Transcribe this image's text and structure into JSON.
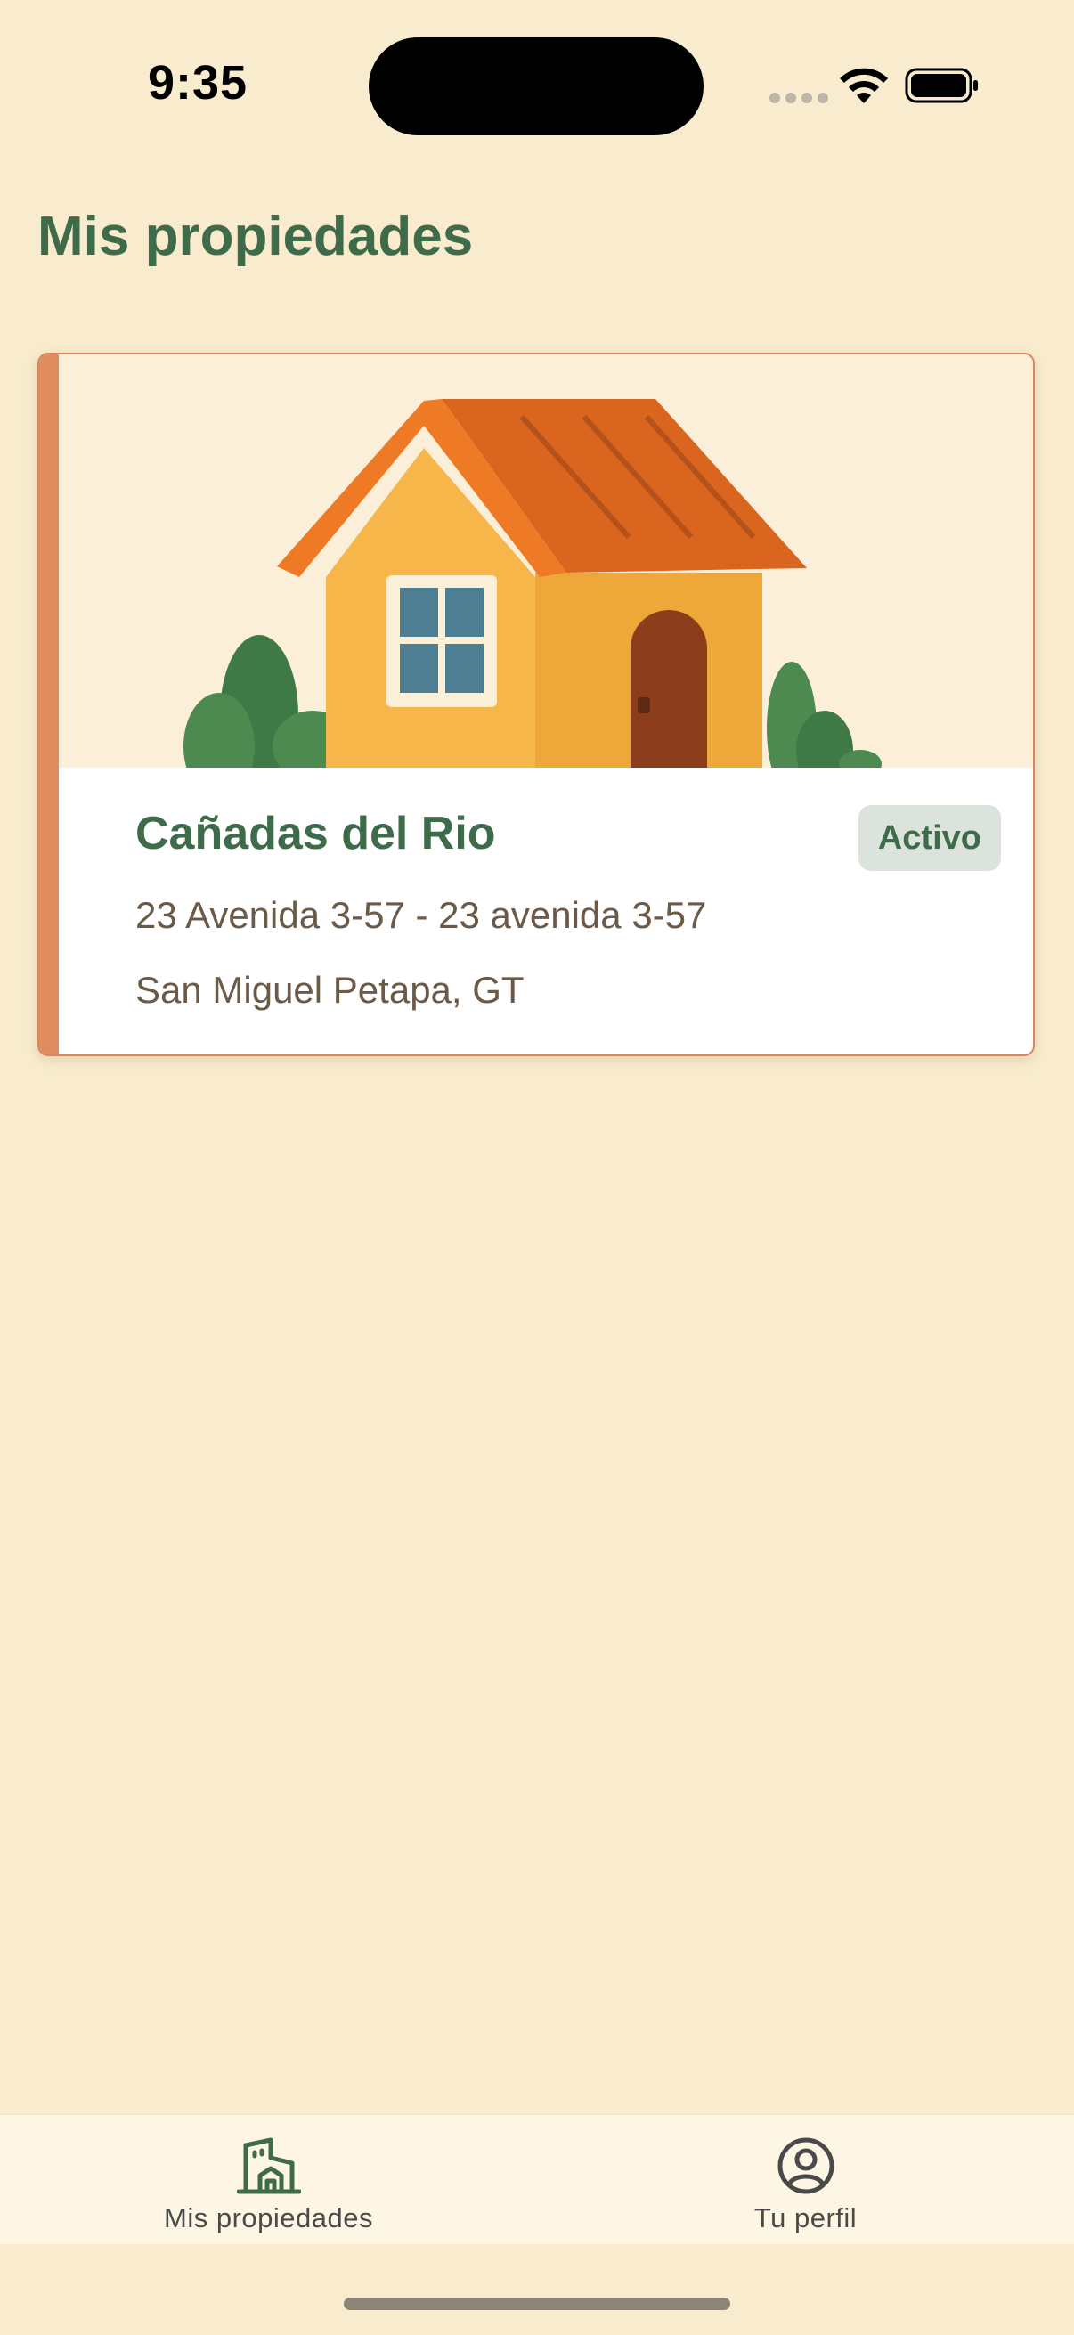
{
  "status_bar": {
    "time": "9:35"
  },
  "page": {
    "title": "Mis propiedades"
  },
  "property_card": {
    "name": "Cañadas del Rio",
    "status": "Activo",
    "address": "23 Avenida 3-57 - 23 avenida 3-57",
    "city": "San Miguel Petapa, GT",
    "image_icon": "house-illustration"
  },
  "tab_bar": {
    "tabs": [
      {
        "label": "Mis propiedades",
        "icon": "building-icon",
        "active": true
      },
      {
        "label": "Tu perfil",
        "icon": "profile-icon",
        "active": false
      }
    ]
  },
  "colors": {
    "background": "#F9ECCE",
    "primary_green": "#3E6B4A",
    "accent_orange": "#E08C5E",
    "badge_bg": "#DCE3DD",
    "tab_bar_bg": "#FDF6E4"
  }
}
